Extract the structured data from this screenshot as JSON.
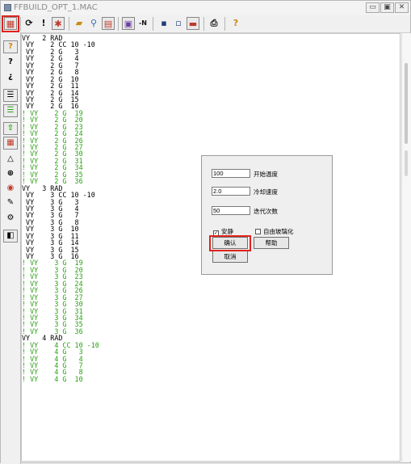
{
  "window": {
    "title": "FFBUILD_OPT_1.MAC"
  },
  "code_lines": [
    {
      "text": "VY   2 RAD",
      "color": "black"
    },
    {
      "text": " VY    2 CC 10 -10",
      "color": "black"
    },
    {
      "text": " VY    2 G   3",
      "color": "black"
    },
    {
      "text": " VY    2 G   4",
      "color": "black"
    },
    {
      "text": " VY    2 G   7",
      "color": "black"
    },
    {
      "text": " VY    2 G   8",
      "color": "black"
    },
    {
      "text": " VY    2 G  10",
      "color": "black"
    },
    {
      "text": " VY    2 G  11",
      "color": "black"
    },
    {
      "text": " VY    2 G  14",
      "color": "black"
    },
    {
      "text": " VY    2 G  15",
      "color": "black"
    },
    {
      "text": " VY    2 G  16",
      "color": "black"
    },
    {
      "text": "! VY    2 G  19",
      "color": "green"
    },
    {
      "text": "! VY    2 G  20",
      "color": "green"
    },
    {
      "text": "! VY    2 G  23",
      "color": "green"
    },
    {
      "text": "! VY    2 G  24",
      "color": "green"
    },
    {
      "text": "! VY    2 G  26",
      "color": "green"
    },
    {
      "text": "! VY    2 G  27",
      "color": "green"
    },
    {
      "text": "! VY    2 G  30",
      "color": "green"
    },
    {
      "text": "! VY    2 G  31",
      "color": "green"
    },
    {
      "text": "! VY    2 G  34",
      "color": "green"
    },
    {
      "text": "! VY    2 G  35",
      "color": "green"
    },
    {
      "text": "! VY    2 G  36",
      "color": "green"
    },
    {
      "text": "VY   3 RAD",
      "color": "black"
    },
    {
      "text": " VY    3 CC 10 -10",
      "color": "black"
    },
    {
      "text": " VY    3 G   3",
      "color": "black"
    },
    {
      "text": " VY    3 G   4",
      "color": "black"
    },
    {
      "text": " VY    3 G   7",
      "color": "black"
    },
    {
      "text": " VY    3 G   8",
      "color": "black"
    },
    {
      "text": " VY    3 G  10",
      "color": "black"
    },
    {
      "text": " VY    3 G  11",
      "color": "black"
    },
    {
      "text": " VY    3 G  14",
      "color": "black"
    },
    {
      "text": " VY    3 G  15",
      "color": "black"
    },
    {
      "text": " VY    3 G  16",
      "color": "black"
    },
    {
      "text": "! VY    3 G  19",
      "color": "green"
    },
    {
      "text": "! VY    3 G  20",
      "color": "green"
    },
    {
      "text": "! VY    3 G  23",
      "color": "green"
    },
    {
      "text": "! VY    3 G  24",
      "color": "green"
    },
    {
      "text": "! VY    3 G  26",
      "color": "green"
    },
    {
      "text": "! VY    3 G  27",
      "color": "green"
    },
    {
      "text": "! VY    3 G  30",
      "color": "green"
    },
    {
      "text": "! VY    3 G  31",
      "color": "green"
    },
    {
      "text": "! VY    3 G  34",
      "color": "green"
    },
    {
      "text": "! VY    3 G  35",
      "color": "green"
    },
    {
      "text": "! VY    3 G  36",
      "color": "green"
    },
    {
      "text": "VY   4 RAD",
      "color": "black"
    },
    {
      "text": "! VY    4 CC 10 -10",
      "color": "green"
    },
    {
      "text": "! VY    4 G   3",
      "color": "green"
    },
    {
      "text": "! VY    4 G   4",
      "color": "green"
    },
    {
      "text": "! VY    4 G   7",
      "color": "green"
    },
    {
      "text": "! VY    4 G   8",
      "color": "green"
    },
    {
      "text": "! VY    4 G  10",
      "color": "green"
    }
  ],
  "dialog": {
    "initial_temp": {
      "value": "100",
      "label": "开始温度"
    },
    "cooling_rate": {
      "value": "2.0",
      "label": "冷却速度"
    },
    "iterations": {
      "value": "50",
      "label": "迭代次数"
    },
    "quiet": {
      "label": "安静",
      "checked": true
    },
    "free_glass": {
      "label": "自由玻璃化",
      "checked": false
    },
    "confirm_label": "确认",
    "help_label": "帮助",
    "cancel_label": "取消"
  },
  "colors": {
    "comment_green": "#2aa013",
    "highlight_red": "#e0231c"
  }
}
